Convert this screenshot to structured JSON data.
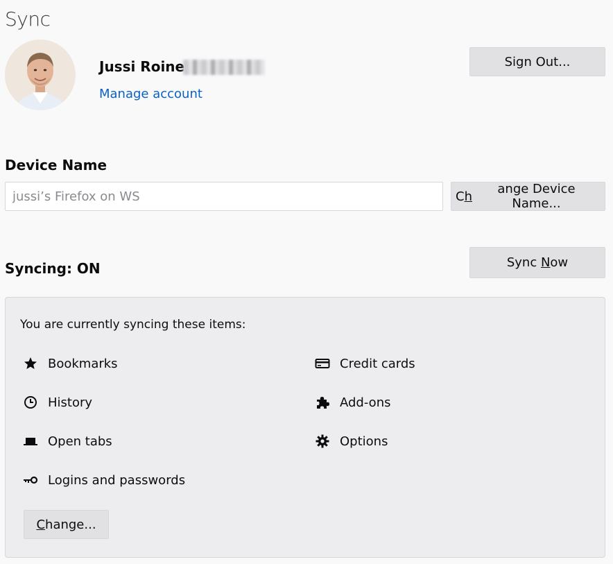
{
  "page": {
    "title": "Sync"
  },
  "profile": {
    "name": "Jussi Roine",
    "manage_account_label": "Manage account",
    "sign_out_label": "Sign Out..."
  },
  "device": {
    "heading": "Device Name",
    "value": "jussi’s Firefox on WS",
    "change_label_pre": "C",
    "change_label_accel": "h",
    "change_label_post": "ange Device Name..."
  },
  "sync": {
    "status": "Syncing: ON",
    "sync_now_pre": "Sync ",
    "sync_now_accel": "N",
    "sync_now_post": "ow",
    "intro": "You are currently syncing these items:",
    "items_left": [
      {
        "label": "Bookmarks",
        "icon": "star-icon"
      },
      {
        "label": "History",
        "icon": "clock-icon"
      },
      {
        "label": "Open tabs",
        "icon": "tab-icon"
      },
      {
        "label": "Logins and passwords",
        "icon": "key-icon"
      }
    ],
    "items_right": [
      {
        "label": "Credit cards",
        "icon": "credit-card-icon"
      },
      {
        "label": "Add-ons",
        "icon": "puzzle-icon"
      },
      {
        "label": "Options",
        "icon": "gear-icon"
      }
    ],
    "change_pre": "",
    "change_accel": "C",
    "change_post": "hange..."
  }
}
